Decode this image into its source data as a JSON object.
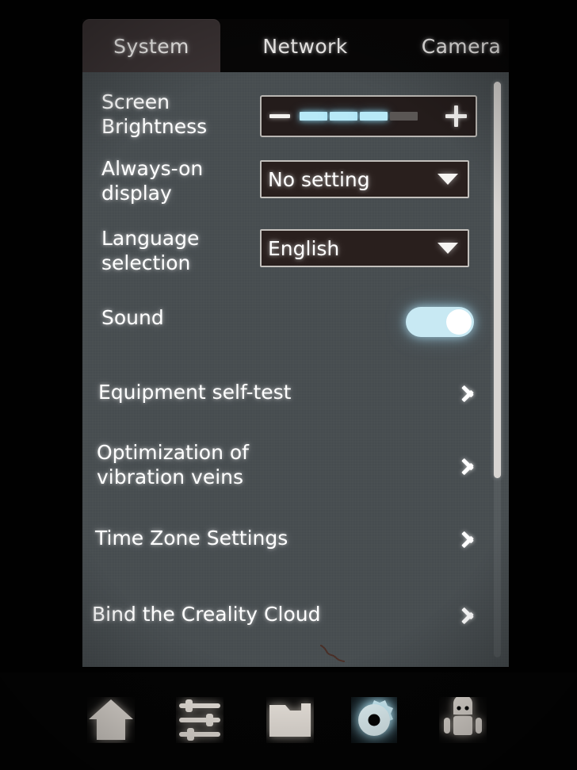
{
  "tabs": [
    {
      "id": "system",
      "label": "System",
      "active": true
    },
    {
      "id": "network",
      "label": "Network",
      "active": false
    },
    {
      "id": "camera",
      "label": "Camera",
      "active": false
    }
  ],
  "settings": {
    "brightness": {
      "label": "Screen\nBrightness",
      "minus_icon": "minus-icon",
      "plus_icon": "plus-icon",
      "segments_total": 4,
      "segments_filled": 3
    },
    "always_on_display": {
      "label": "Always-on\ndisplay",
      "value": "No setting",
      "arrow_icon": "chevron-down-icon"
    },
    "language_selection": {
      "label": "Language\nselection",
      "value": "English",
      "arrow_icon": "chevron-down-icon"
    },
    "sound": {
      "label": "Sound",
      "state": "on"
    }
  },
  "list_items": [
    {
      "id": "equipment-self-test",
      "label": "Equipment self-test",
      "chevron": "chevron-right-icon"
    },
    {
      "id": "vibration-optimization",
      "label": "Optimization of\nvibration veins",
      "chevron": "chevron-right-icon"
    },
    {
      "id": "time-zone-settings",
      "label": "Time Zone Settings",
      "chevron": "chevron-right-icon"
    },
    {
      "id": "bind-creality-cloud",
      "label": "Bind the Creality Cloud",
      "chevron": "chevron-right-icon"
    }
  ],
  "bottom_nav": [
    {
      "id": "home",
      "icon": "home-icon",
      "active": false
    },
    {
      "id": "tune",
      "icon": "sliders-icon",
      "active": false
    },
    {
      "id": "files",
      "icon": "folder-icon",
      "active": false
    },
    {
      "id": "settings",
      "icon": "gear-icon",
      "active": true
    },
    {
      "id": "robot",
      "icon": "robot-icon",
      "active": false
    }
  ],
  "colors": {
    "panel_background": "#464c4f",
    "tab_active_background": "#3a3233",
    "screen_background": "#040404",
    "field_background": "#291f1d",
    "field_border": "#c3c0bc",
    "accent_on": "#b7e9f7",
    "toggle_on": "#c8e9f3",
    "text": "#ffffff"
  }
}
